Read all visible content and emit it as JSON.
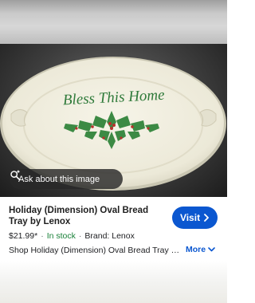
{
  "image_overlay": {
    "ask_label": "Ask about this image",
    "plate_text": "Bless This Home"
  },
  "product": {
    "title": "Holiday (Dimension) Oval Bread Tray by Lenox",
    "price": "$21.99*",
    "stock": "In stock",
    "brand": "Brand: Lenox",
    "description": "Shop Holiday (Dimension) Oval Bread Tray by Lenox",
    "visit_label": "Visit",
    "more_label": "More"
  },
  "colors": {
    "accent": "#0b57d0",
    "stock_green": "#188038"
  }
}
